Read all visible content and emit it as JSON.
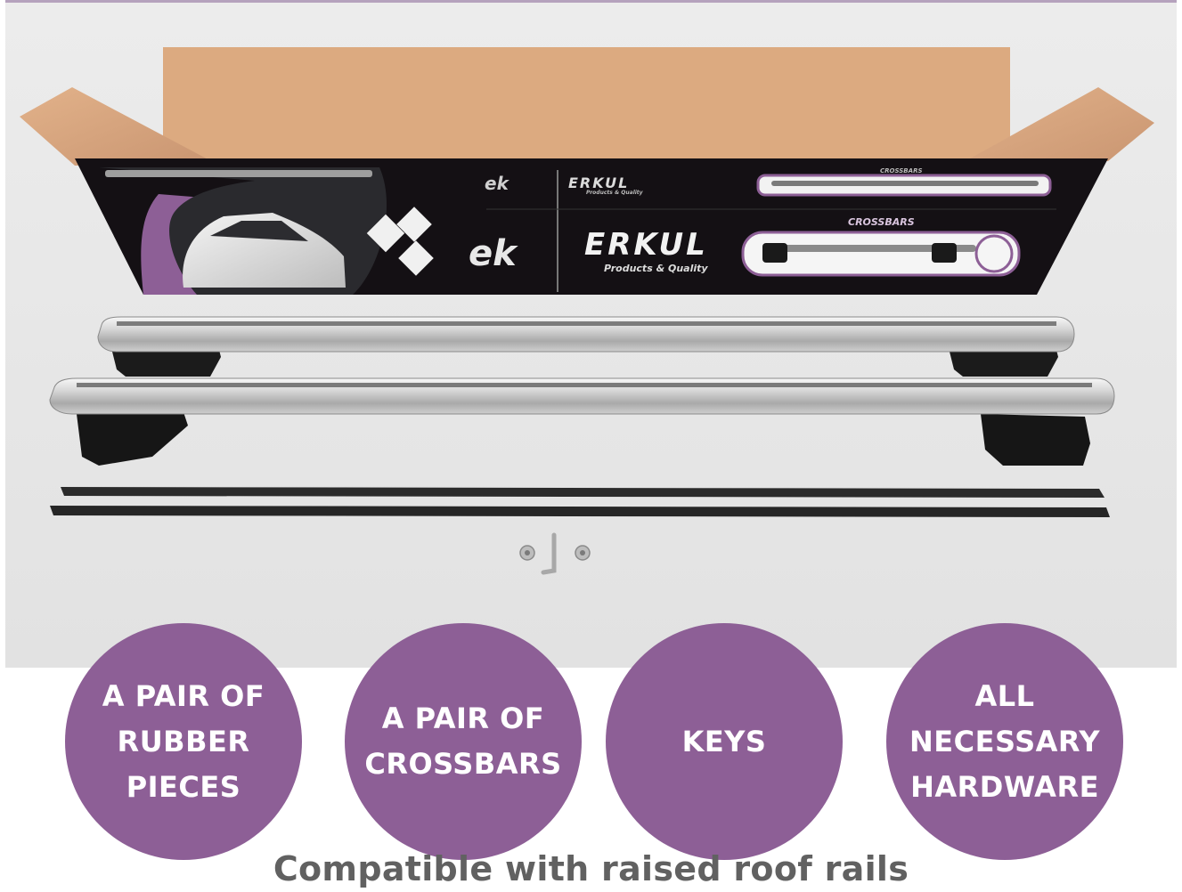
{
  "box": {
    "brand_name": "ERKUL",
    "brand_tagline": "Products & Quality",
    "brand_initials": "ek",
    "product_label": "CROSSBARS",
    "product_label_top": "CROSSBARS",
    "brand_tagline_top": "Products & Quality"
  },
  "features": [
    {
      "lines": [
        "A PAIR OF",
        "RUBBER",
        "PIECES"
      ]
    },
    {
      "lines": [
        "A PAIR OF",
        "CROSSBARS"
      ]
    },
    {
      "lines": [
        "KEYS"
      ]
    },
    {
      "lines": [
        "ALL",
        "NECESSARY",
        "HARDWARE"
      ]
    }
  ],
  "caption": "Compatible with raised roof rails",
  "colors": {
    "accent_purple": "#8d5f96",
    "cardboard": "#d9a67c",
    "box_black": "#141014",
    "caption_gray": "#616161"
  }
}
